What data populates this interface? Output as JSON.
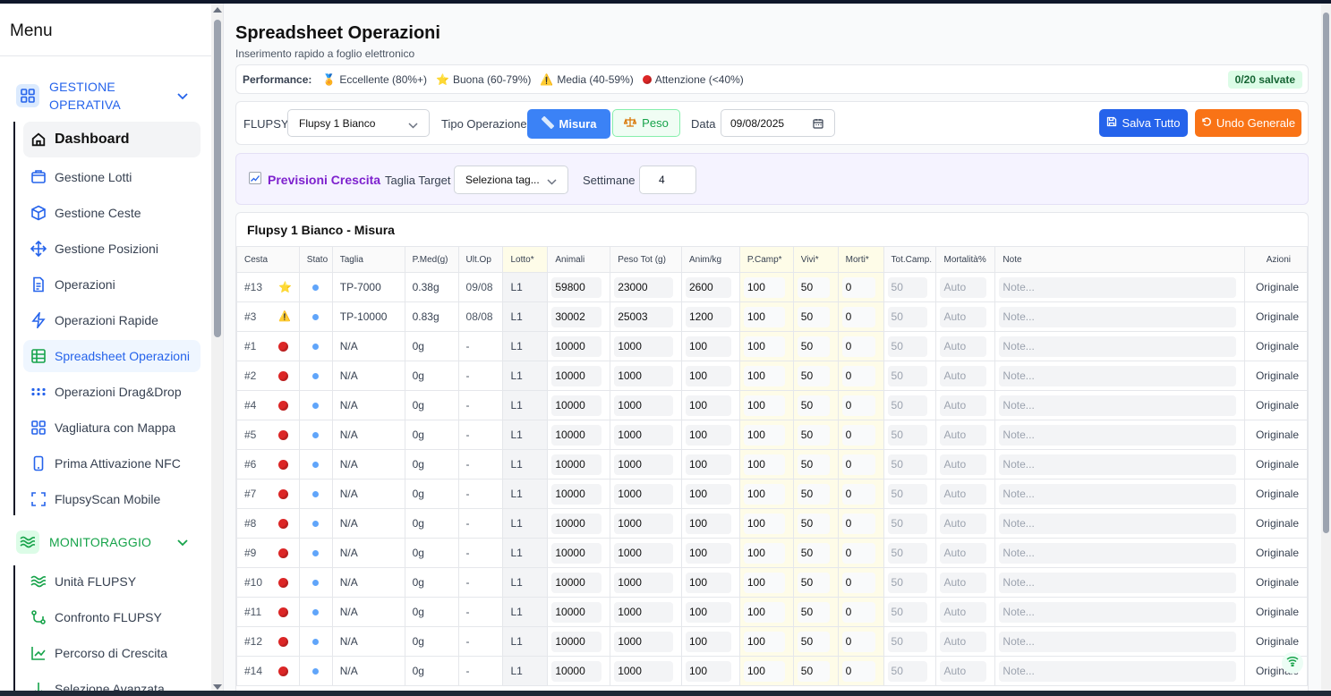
{
  "sidebar": {
    "title": "Menu",
    "group1": {
      "label_line1": "GESTIONE",
      "label_line2": "OPERATIVA"
    },
    "items": [
      {
        "label": "Dashboard",
        "icon": "home-icon"
      },
      {
        "label": "Gestione Lotti",
        "icon": "package-icon"
      },
      {
        "label": "Gestione Ceste",
        "icon": "box-icon"
      },
      {
        "label": "Gestione Posizioni",
        "icon": "move-icon"
      },
      {
        "label": "Operazioni",
        "icon": "file-text-icon"
      },
      {
        "label": "Operazioni Rapide",
        "icon": "zap-icon"
      },
      {
        "label": "Spreadsheet Operazioni",
        "icon": "table-icon"
      },
      {
        "label": "Operazioni Drag&Drop",
        "icon": "grip-icon"
      },
      {
        "label": "Vagliatura con Mappa",
        "icon": "grid-icon"
      },
      {
        "label": "Prima Attivazione NFC",
        "icon": "smartphone-icon"
      },
      {
        "label": "FlupsyScan Mobile",
        "icon": "scan-icon"
      }
    ],
    "group2": {
      "label": "MONITORAGGIO"
    },
    "items2": [
      {
        "label": "Unità FLUPSY",
        "icon": "waves-icon"
      },
      {
        "label": "Confronto FLUPSY",
        "icon": "git-compare-icon"
      },
      {
        "label": "Percorso di Crescita",
        "icon": "chart-line-icon"
      },
      {
        "label": "Selezione Avanzata",
        "icon": "arrow-down-icon"
      }
    ]
  },
  "page": {
    "title": "Spreadsheet Operazioni",
    "subtitle": "Inserimento rapido a foglio elettronico"
  },
  "performance": {
    "label": "Performance:",
    "items": [
      "Eccellente (80%+)",
      "Buona (60-79%)",
      "Media (40-59%)",
      "Attenzione (<40%)"
    ],
    "saved": "0/20 salvate"
  },
  "controls": {
    "flupsy_label": "FLUPSY",
    "flupsy_value": "Flupsy 1 Bianco",
    "op_type_label": "Tipo Operazione",
    "op_misura": "Misura",
    "op_peso": "Peso",
    "date_label": "Data",
    "date_value": "09/08/2025",
    "save_all": "Salva Tutto",
    "undo_all": "Undo Generale"
  },
  "forecast": {
    "title": "Previsioni Crescita",
    "target_label": "Taglia Target",
    "target_placeholder": "Seleziona tag...",
    "weeks_label": "Settimane",
    "weeks_value": "4"
  },
  "table": {
    "title": "Flupsy 1 Bianco - Misura",
    "headers": [
      "Cesta",
      "Stato",
      "Taglia",
      "P.Med(g)",
      "Ult.Op",
      "Lotto*",
      "Animali",
      "Peso Tot (g)",
      "Anim/kg",
      "P.Camp*",
      "Vivi*",
      "Morti*",
      "Tot.Camp.",
      "Mortalità%",
      "Note",
      "Azioni"
    ],
    "note_placeholder": "Note...",
    "auto": "Auto",
    "rows": [
      {
        "cesta": "#13",
        "perf": "star",
        "taglia": "TP-7000",
        "pmed": "0.38g",
        "ultop": "09/08",
        "lotto": "L1",
        "animali": "59800",
        "peso": "23000",
        "animkg": "2600",
        "pcamp": "100",
        "vivi": "50",
        "morti": "0",
        "totcamp": "50",
        "azioni": "Originale"
      },
      {
        "cesta": "#3",
        "perf": "warn",
        "taglia": "TP-10000",
        "pmed": "0.83g",
        "ultop": "08/08",
        "lotto": "L1",
        "animali": "30002",
        "peso": "25003",
        "animkg": "1200",
        "pcamp": "100",
        "vivi": "50",
        "morti": "0",
        "totcamp": "50",
        "azioni": "Originale"
      },
      {
        "cesta": "#1",
        "perf": "red",
        "taglia": "N/A",
        "pmed": "0g",
        "ultop": "-",
        "lotto": "L1",
        "animali": "10000",
        "peso": "1000",
        "animkg": "100",
        "pcamp": "100",
        "vivi": "50",
        "morti": "0",
        "totcamp": "50",
        "azioni": "Originale"
      },
      {
        "cesta": "#2",
        "perf": "red",
        "taglia": "N/A",
        "pmed": "0g",
        "ultop": "-",
        "lotto": "L1",
        "animali": "10000",
        "peso": "1000",
        "animkg": "100",
        "pcamp": "100",
        "vivi": "50",
        "morti": "0",
        "totcamp": "50",
        "azioni": "Originale"
      },
      {
        "cesta": "#4",
        "perf": "red",
        "taglia": "N/A",
        "pmed": "0g",
        "ultop": "-",
        "lotto": "L1",
        "animali": "10000",
        "peso": "1000",
        "animkg": "100",
        "pcamp": "100",
        "vivi": "50",
        "morti": "0",
        "totcamp": "50",
        "azioni": "Originale"
      },
      {
        "cesta": "#5",
        "perf": "red",
        "taglia": "N/A",
        "pmed": "0g",
        "ultop": "-",
        "lotto": "L1",
        "animali": "10000",
        "peso": "1000",
        "animkg": "100",
        "pcamp": "100",
        "vivi": "50",
        "morti": "0",
        "totcamp": "50",
        "azioni": "Originale"
      },
      {
        "cesta": "#6",
        "perf": "red",
        "taglia": "N/A",
        "pmed": "0g",
        "ultop": "-",
        "lotto": "L1",
        "animali": "10000",
        "peso": "1000",
        "animkg": "100",
        "pcamp": "100",
        "vivi": "50",
        "morti": "0",
        "totcamp": "50",
        "azioni": "Originale"
      },
      {
        "cesta": "#7",
        "perf": "red",
        "taglia": "N/A",
        "pmed": "0g",
        "ultop": "-",
        "lotto": "L1",
        "animali": "10000",
        "peso": "1000",
        "animkg": "100",
        "pcamp": "100",
        "vivi": "50",
        "morti": "0",
        "totcamp": "50",
        "azioni": "Originale"
      },
      {
        "cesta": "#8",
        "perf": "red",
        "taglia": "N/A",
        "pmed": "0g",
        "ultop": "-",
        "lotto": "L1",
        "animali": "10000",
        "peso": "1000",
        "animkg": "100",
        "pcamp": "100",
        "vivi": "50",
        "morti": "0",
        "totcamp": "50",
        "azioni": "Originale"
      },
      {
        "cesta": "#9",
        "perf": "red",
        "taglia": "N/A",
        "pmed": "0g",
        "ultop": "-",
        "lotto": "L1",
        "animali": "10000",
        "peso": "1000",
        "animkg": "100",
        "pcamp": "100",
        "vivi": "50",
        "morti": "0",
        "totcamp": "50",
        "azioni": "Originale"
      },
      {
        "cesta": "#10",
        "perf": "red",
        "taglia": "N/A",
        "pmed": "0g",
        "ultop": "-",
        "lotto": "L1",
        "animali": "10000",
        "peso": "1000",
        "animkg": "100",
        "pcamp": "100",
        "vivi": "50",
        "morti": "0",
        "totcamp": "50",
        "azioni": "Originale"
      },
      {
        "cesta": "#11",
        "perf": "red",
        "taglia": "N/A",
        "pmed": "0g",
        "ultop": "-",
        "lotto": "L1",
        "animali": "10000",
        "peso": "1000",
        "animkg": "100",
        "pcamp": "100",
        "vivi": "50",
        "morti": "0",
        "totcamp": "50",
        "azioni": "Originale"
      },
      {
        "cesta": "#12",
        "perf": "red",
        "taglia": "N/A",
        "pmed": "0g",
        "ultop": "-",
        "lotto": "L1",
        "animali": "10000",
        "peso": "1000",
        "animkg": "100",
        "pcamp": "100",
        "vivi": "50",
        "morti": "0",
        "totcamp": "50",
        "azioni": "Originale"
      },
      {
        "cesta": "#14",
        "perf": "red",
        "taglia": "N/A",
        "pmed": "0g",
        "ultop": "-",
        "lotto": "L1",
        "animali": "10000",
        "peso": "1000",
        "animkg": "100",
        "pcamp": "100",
        "vivi": "50",
        "morti": "0",
        "totcamp": "50",
        "azioni": "Originale"
      }
    ]
  },
  "colors": {
    "primary": "#3b82f6",
    "save": "#2563eb",
    "undo": "#f97316",
    "forecast": "#7e22ce",
    "monitor": "#16a34a"
  }
}
